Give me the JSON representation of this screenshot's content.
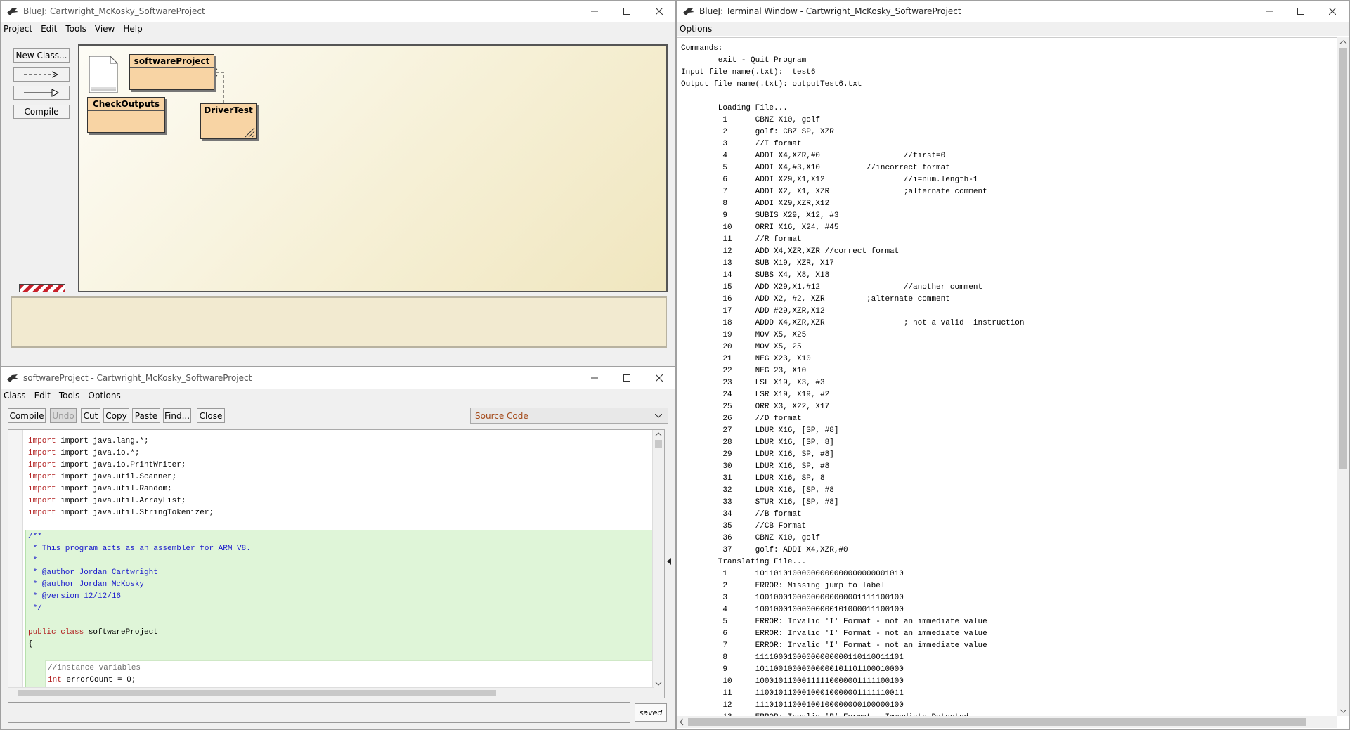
{
  "project_window": {
    "title": "BlueJ:  Cartwright_McKosky_SoftwareProject",
    "menu": [
      "Project",
      "Edit",
      "Tools",
      "View",
      "Help"
    ],
    "buttons": {
      "new_class": "New Class...",
      "compile": "Compile"
    },
    "classes": [
      {
        "name": "softwareProject"
      },
      {
        "name": "CheckOutputs"
      },
      {
        "name": "DriverTest"
      }
    ]
  },
  "editor_window": {
    "title": "softwareProject - Cartwright_McKosky_SoftwareProject",
    "menu": [
      "Class",
      "Edit",
      "Tools",
      "Options"
    ],
    "toolbar": [
      "Compile",
      "Undo",
      "Cut",
      "Copy",
      "Paste",
      "Find...",
      "Close"
    ],
    "view_select": "Source Code",
    "status": "saved",
    "code": [
      "import java.lang.*;",
      "import java.io.*;",
      "import java.io.PrintWriter;",
      "import java.util.Scanner;",
      "import java.util.Random;",
      "import java.util.ArrayList;",
      "import java.util.StringTokenizer;",
      "/**",
      " * This program acts as an assembler for ARM V8.",
      " *",
      " * @author Jordan Cartwright",
      " * @author Jordan McKosky",
      " * @version 12/12/16",
      " */",
      "public class softwareProject",
      "{",
      "//instance variables",
      "int errorCount = 0;"
    ]
  },
  "terminal_window": {
    "title": "BlueJ: Terminal Window - Cartwright_McKosky_SoftwareProject",
    "menu": [
      "Options"
    ],
    "lines": [
      "Commands:",
      "        exit - Quit Program",
      "Input file name(.txt):  test6",
      "Output file name(.txt): outputTest6.txt",
      "",
      "        Loading File...",
      "         1      CBNZ X10, golf",
      "         2      golf: CBZ SP, XZR",
      "         3      //I format",
      "         4      ADDI X4,XZR,#0                  //first=0",
      "         5      ADDI X4,#3,X10          //incorrect format",
      "         6      ADDI X29,X1,X12                 //i=num.length-1",
      "         7      ADDI X2, X1, XZR                ;alternate comment",
      "         8      ADDI X29,XZR,X12",
      "         9      SUBIS X29, X12, #3",
      "         10     ORRI X16, X24, #45",
      "         11     //R format",
      "         12     ADD X4,XZR,XZR //correct format",
      "         13     SUB X19, XZR, X17",
      "         14     SUBS X4, X8, X18",
      "         15     ADD X29,X1,#12                  //another comment",
      "         16     ADD X2, #2, XZR         ;alternate comment",
      "         17     ADD #29,XZR,X12",
      "         18     ADDD X4,XZR,XZR                 ; not a valid  instruction",
      "         19     MOV X5, X25",
      "         20     MOV X5, 25",
      "         21     NEG X23, X10",
      "         22     NEG 23, X10",
      "         23     LSL X19, X3, #3",
      "         24     LSR X19, X19, #2",
      "         25     ORR X3, X22, X17",
      "         26     //D format",
      "         27     LDUR X16, [SP, #8]",
      "         28     LDUR X16, [SP, 8]",
      "         29     LDUR X16, SP, #8]",
      "         30     LDUR X16, SP, #8",
      "         31     LDUR X16, SP, 8",
      "         32     LDUR X16, [SP, #8",
      "         33     STUR X16, [SP, #8]",
      "         34     //B format",
      "         35     //CB Format",
      "         36     CBNZ X10, golf",
      "         37     golf: ADDI X4,XZR,#0",
      "        Translating File...",
      "         1      10110101000000000000000000001010",
      "         2      ERROR: Missing jump to label",
      "         3      10010001000000000000001111100100",
      "         4      10010001000000000101000011100100",
      "         5      ERROR: Invalid 'I' Format - not an immediate value",
      "         6      ERROR: Invalid 'I' Format - not an immediate value",
      "         7      ERROR: Invalid 'I' Format - not an immediate value",
      "         8      11110001000000000000110110011101",
      "         9      10110010000000000101101100010000",
      "         10     10001011000111110000001111100100",
      "         11     11001011000100010000001111110011",
      "         12     11101011000100100000000100000100",
      "         13     ERROR: Invalid 'R' Format - Immediate Detected"
    ]
  }
}
